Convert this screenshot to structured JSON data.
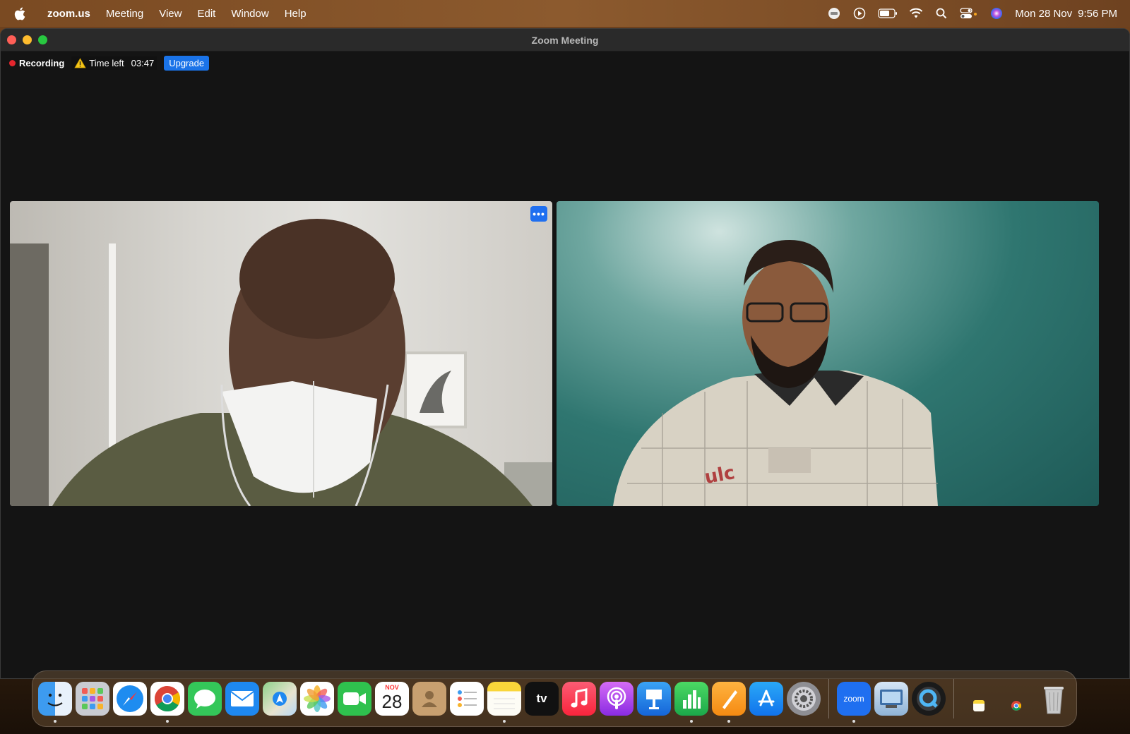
{
  "menubar": {
    "app_name": "zoom.us",
    "items": [
      "Meeting",
      "View",
      "Edit",
      "Window",
      "Help"
    ],
    "date": "Mon 28 Nov",
    "time": "9:56 PM"
  },
  "window": {
    "title": "Zoom Meeting"
  },
  "status": {
    "recording_label": "Recording",
    "time_left_label": "Time left",
    "time_left_value": "03:47",
    "upgrade_label": "Upgrade"
  },
  "tiles": {
    "more_label": "•••"
  },
  "dock": {
    "calendar_month": "NOV",
    "calendar_day": "28",
    "tv_label": "tv",
    "zoom_label": "zoom"
  },
  "colors": {
    "recording_dot": "#e5262e",
    "upgrade_button": "#1a73e8",
    "more_button": "#1f6ff0",
    "window_bg": "#141414"
  }
}
